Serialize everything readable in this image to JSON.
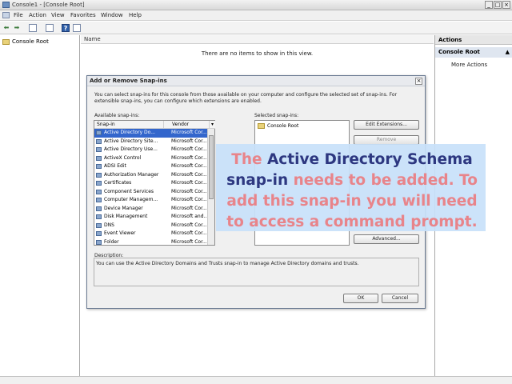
{
  "window": {
    "title": "Console1 - [Console Root]",
    "menu": [
      "File",
      "Action",
      "View",
      "Favorites",
      "Window",
      "Help"
    ]
  },
  "tree": {
    "root": "Console Root"
  },
  "center": {
    "column_header": "Name",
    "empty_message": "There are no items to show in this view."
  },
  "actions": {
    "header": "Actions",
    "section": "Console Root",
    "more": "More Actions"
  },
  "dialog": {
    "title": "Add or Remove Snap-ins",
    "close": "×",
    "intro": "You can select snap-ins for this console from those available on your computer and configure the selected set of snap-ins. For extensible snap-ins, you can configure which extensions are enabled.",
    "available_label": "Available snap-ins:",
    "col_snapin": "Snap-in",
    "col_vendor": "Vendor",
    "selected_label": "Selected snap-ins:",
    "selected_item": "Console Root",
    "snapins": [
      {
        "name": "Active Directory Do...",
        "vendor": "Microsoft Cor...",
        "selected": true
      },
      {
        "name": "Active Directory Site...",
        "vendor": "Microsoft Cor..."
      },
      {
        "name": "Active Directory Use...",
        "vendor": "Microsoft Cor..."
      },
      {
        "name": "ActiveX Control",
        "vendor": "Microsoft Cor..."
      },
      {
        "name": "ADSI Edit",
        "vendor": "Microsoft Cor..."
      },
      {
        "name": "Authorization Manager",
        "vendor": "Microsoft Cor..."
      },
      {
        "name": "Certificates",
        "vendor": "Microsoft Cor..."
      },
      {
        "name": "Component Services",
        "vendor": "Microsoft Cor..."
      },
      {
        "name": "Computer Managem...",
        "vendor": "Microsoft Cor..."
      },
      {
        "name": "Device Manager",
        "vendor": "Microsoft Cor..."
      },
      {
        "name": "Disk Management",
        "vendor": "Microsoft and..."
      },
      {
        "name": "DNS",
        "vendor": "Microsoft Cor..."
      },
      {
        "name": "Event Viewer",
        "vendor": "Microsoft Cor..."
      },
      {
        "name": "Folder",
        "vendor": "Microsoft Cor..."
      }
    ],
    "buttons": {
      "edit_extensions": "Edit Extensions...",
      "remove": "Remove",
      "advanced": "Advanced...",
      "ok": "OK",
      "cancel": "Cancel"
    },
    "description_label": "Description:",
    "description": "You can use the Active Directory Domains and Trusts snap-in to manage Active Directory domains and trusts."
  },
  "overlay": {
    "part1": "The ",
    "part2": "Active Directory Schema snap-in",
    "part3": " needs to be added. To add this snap-in you will need to access a command prompt.",
    "color_pink": "#e8848a",
    "color_blue": "#2d3780"
  }
}
